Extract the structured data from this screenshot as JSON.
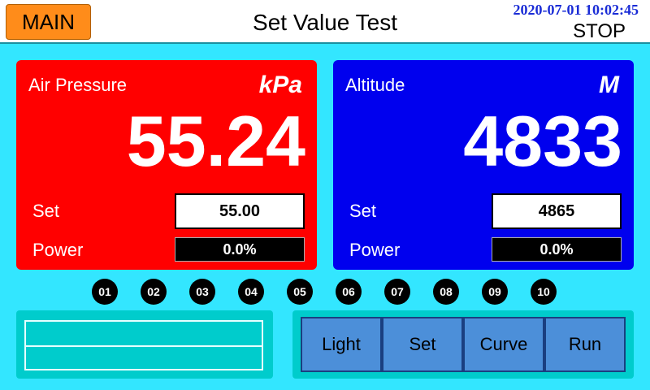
{
  "header": {
    "main_label": "MAIN",
    "title": "Set Value Test",
    "datetime": "2020-07-01 10:02:45",
    "state": "STOP"
  },
  "pressure": {
    "label": "Air Pressure",
    "unit": "kPa",
    "value": "55.24",
    "set_label": "Set",
    "set_value": "55.00",
    "power_label": "Power",
    "power_value": "0.0%"
  },
  "altitude": {
    "label": "Altitude",
    "unit": "M",
    "value": "4833",
    "set_label": "Set",
    "set_value": "4865",
    "power_label": "Power",
    "power_value": "0.0%"
  },
  "channels": [
    "01",
    "02",
    "03",
    "04",
    "05",
    "06",
    "07",
    "08",
    "09",
    "10"
  ],
  "buttons": {
    "light": "Light",
    "set": "Set",
    "curve": "Curve",
    "run": "Run"
  },
  "colors": {
    "pressure_panel": "#ff0000",
    "altitude_panel": "#0000ee",
    "background": "#33e6ff",
    "main_button": "#ff8c1a"
  }
}
